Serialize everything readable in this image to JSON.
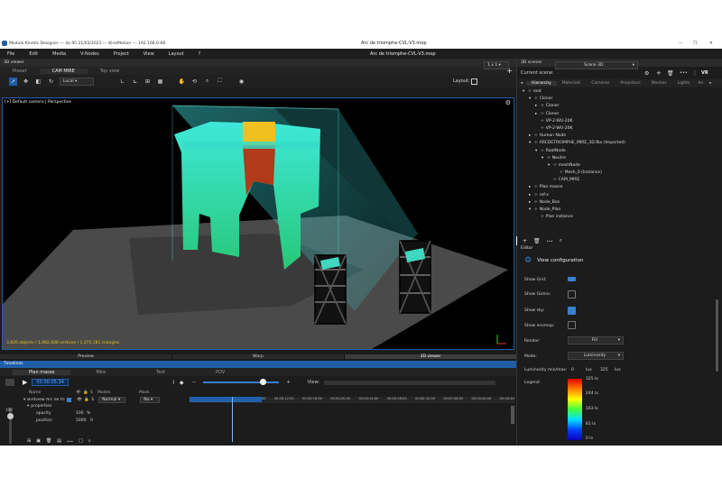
{
  "window": {
    "app_title": "Modulo Kinetic Designer  ---  4x.95 21/03/2021  ---  KineMotion  ---  192.168.0.68",
    "doc_title": "Arc de triomphe-CVL-V3.mop",
    "controls": [
      "—",
      "❐",
      "✕"
    ]
  },
  "menu": [
    "File",
    "Edit",
    "Media",
    "V-Nodes",
    "Project",
    "View",
    "Layout",
    "?"
  ],
  "viewer": {
    "title": "3D viewer",
    "tabs": [
      "Preset",
      "CAM MIRE",
      "Top view"
    ],
    "active_tab": "CAM MIRE",
    "dropdown": "Local",
    "layout_label": "Layout:",
    "layout_value": "1 x 1",
    "camera": "[+] Default camera | Perspective",
    "stats": "3,826 objects / 1,082,608 vertices / 1,375,181 triangles",
    "bottom_tabs": [
      "Preview",
      "Warp",
      "3D viewer"
    ],
    "active_bottom": "3D viewer"
  },
  "scenes": {
    "title": "3D scenes",
    "current_label": "Current scene:",
    "current_value": "Scene 3D",
    "vr": "VR",
    "tabs": [
      "Hierarchy",
      "Materials",
      "Cameras",
      "Projectors",
      "Meshes",
      "Lights",
      "An"
    ],
    "tree": [
      {
        "d": 0,
        "e": "▾",
        "t": "root"
      },
      {
        "d": 1,
        "e": "▾",
        "t": "Cloner"
      },
      {
        "d": 2,
        "e": "▸",
        "t": "Cloner"
      },
      {
        "d": 2,
        "e": "▸",
        "t": "Cloner"
      },
      {
        "d": 2,
        "e": "",
        "t": "VP-2-WU-20K"
      },
      {
        "d": 2,
        "e": "",
        "t": "VP-2-WU-20K"
      },
      {
        "d": 1,
        "e": "▸",
        "t": "Human Node"
      },
      {
        "d": 1,
        "e": "▾",
        "t": "ARCDETRIOMPHE_MIRE_3D.fbx (Imported)"
      },
      {
        "d": 2,
        "e": "▾",
        "t": "RootNode"
      },
      {
        "d": 3,
        "e": "▾",
        "t": "Neutre"
      },
      {
        "d": 4,
        "e": "▾",
        "t": "meshNode"
      },
      {
        "d": 5,
        "e": "",
        "t": "Mesh_0 (Instance)"
      },
      {
        "d": 4,
        "e": "",
        "t": "CAM_MIRE"
      },
      {
        "d": 1,
        "e": "▸",
        "t": "Plan masse"
      },
      {
        "d": 1,
        "e": "▸",
        "t": "ref-x"
      },
      {
        "d": 1,
        "e": "▸",
        "t": "Node_Box"
      },
      {
        "d": 1,
        "e": "▾",
        "t": "Node_Plan"
      },
      {
        "d": 2,
        "e": "",
        "t": "Plan instance"
      }
    ]
  },
  "editor": {
    "title": "Editor",
    "heading": "View configuration",
    "show_grid": "Show Grid:",
    "show_gizmo": "Show Gizmo:",
    "show_sky": "Show sky:",
    "show_envmap": "Show envmap:",
    "render_label": "Render:",
    "render_value": "Fill",
    "mode_label": "Mode:",
    "mode_value": "Luminosity",
    "lummm_label": "Luminosity min/max:",
    "lum_min": "0",
    "lum_max": "325",
    "lux": "lux",
    "legend_label": "Legend:",
    "legend_values": [
      "325 lx",
      "244 lx",
      "163 lx",
      "81 lx",
      "0 lx"
    ],
    "toggles": {
      "grid": true,
      "gizmo": false,
      "sky": true,
      "envmap": false
    }
  },
  "timelines": {
    "title": "Timelines",
    "tabs": [
      "Plan masse",
      "Mire",
      "Test",
      "POV"
    ],
    "active": "Plan masse",
    "timecode": "00:00:05:34",
    "view_label": "View:",
    "cols": [
      "Name",
      "S",
      "Modes",
      "Mask"
    ],
    "layer_name": "Birdview Arc de tri",
    "mode": "Normal",
    "mask": "No",
    "props_label": "properties",
    "opacity_label": "opacity",
    "opacity_value": "100",
    "opacity_unit": "%",
    "position_label": "position",
    "position_value": "5000",
    "position_extra": "0",
    "vol": "100",
    "ruler": [
      "00:00:00:00",
      "00:00:04:00",
      "00:00:08:00",
      "00:00:12:00",
      "00:00:16:00",
      "00:00:20:00",
      "00:00:24:00",
      "00:00:28:00",
      "00:00:32:00",
      "00:00:36:00",
      "00:00:40:00",
      "00:00:44"
    ]
  },
  "colors": {
    "accent": "#1f5fa8",
    "cyan": "#3fe0d0",
    "green": "#2fd07a",
    "yellow": "#f0c020",
    "red": "#b03a1a"
  }
}
